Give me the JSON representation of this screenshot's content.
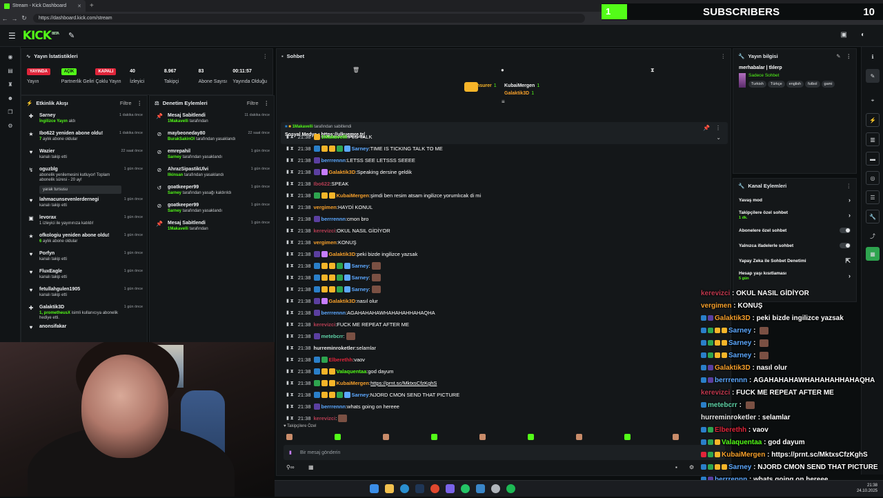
{
  "browser": {
    "tab_title": "Stream - Kick Dashboard",
    "url": "https://dashboard.kick.com/stream"
  },
  "overlay": {
    "subs_bar_value": "1",
    "subs_label": "SUBSCRIBERS",
    "subs_count": "10"
  },
  "app": {
    "logo": "KICK",
    "logo_badge": "BETA"
  },
  "stats": {
    "title": "Yayın İstatistikleri",
    "items": [
      {
        "value": "YAYINDA",
        "label": "Yayın",
        "color": "#e0253a"
      },
      {
        "value": "AÇIK",
        "label": "Partnerlik Geliri",
        "color": "#53fc18"
      },
      {
        "value": "KAPALI",
        "label": "Çoklu Yayın",
        "color": "#e0253a"
      },
      {
        "value": "40",
        "label": "İzleyici"
      },
      {
        "value": "8.967",
        "label": "Takipçi"
      },
      {
        "value": "83",
        "label": "Abone Sayısı"
      },
      {
        "value": "00:11:57",
        "label": "Yayında Olduğu"
      }
    ]
  },
  "feed": {
    "title": "Etkinlik Akışı",
    "filter": "Filtre",
    "items": [
      {
        "icon": "gift",
        "title": "Sarney",
        "sub": "İngilizce Yayın",
        "subrest": " aldı",
        "time": "1 dakika önce"
      },
      {
        "icon": "star",
        "title": "Ibo622 yeniden abone oldu!",
        "sub": "7",
        "subrest": " aylık abone oldular",
        "time": "1 dakika önce"
      },
      {
        "icon": "heart",
        "title": "Wazier",
        "sub": "",
        "subrest": "kanalı takip etti",
        "time": "22 saat önce"
      },
      {
        "icon": "renew",
        "title": "oguzblg",
        "sub": "",
        "subrest": "abonelik yenilemesini kutluyor! Toplam abonelik süresi - 20 ay!",
        "time": "1 gün önce",
        "quote": "yarak tursusu"
      },
      {
        "icon": "heart",
        "title": "lahmacunsevenlerdernegi",
        "sub": "",
        "subrest": "kanalı takip etti",
        "time": "1 gün önce"
      },
      {
        "icon": "tv",
        "title": "levorax",
        "sub": "",
        "subrest": "1 izleyici ile yayınınıza katıldı!",
        "time": "1 gün önce"
      },
      {
        "icon": "star",
        "title": "ofkologiu yeniden abone oldu!",
        "sub": "6",
        "subrest": " aylık abone oldular",
        "time": "1 gün önce"
      },
      {
        "icon": "heart",
        "title": "Porfyn",
        "sub": "",
        "subrest": "kanalı takip etti",
        "time": "1 gün önce"
      },
      {
        "icon": "heart",
        "title": "FluxEagle",
        "sub": "",
        "subrest": "kanalı takip etti",
        "time": "1 gün önce"
      },
      {
        "icon": "heart",
        "title": "fetullahgulen1905",
        "sub": "",
        "subrest": "kanalı takip etti",
        "time": "1 gün önce"
      },
      {
        "icon": "gift",
        "title": "Galaktik3D",
        "sub": "1, prometheusX",
        "subrest": " isimli kullanıcıya abonelik hediye etti.",
        "time": "1 gün önce"
      },
      {
        "icon": "heart",
        "title": "anonsifakar",
        "sub": "",
        "subrest": "",
        "time": ""
      }
    ]
  },
  "mod": {
    "title": "Denetim Eylemleri",
    "filter": "Filtre",
    "items": [
      {
        "icon": "pin",
        "title": "Mesaj Sabitlendi",
        "sub": "1Makavelli",
        "subrest": " tarafından",
        "time": "11 dakika önce"
      },
      {
        "icon": "ban",
        "title": "maybeoneday80",
        "sub": "BurakSakinOl",
        "subrest": " tarafından yasaklandı",
        "time": "22 saat önce"
      },
      {
        "icon": "ban",
        "title": "emrepahil",
        "sub": "Sarney",
        "subrest": " tarafından yasaklandı",
        "time": "1 gün önce"
      },
      {
        "icon": "ban",
        "title": "AhrazSipastikUlvi",
        "sub": "Ilkinsan",
        "subrest": " tarafından yasaklandı",
        "time": "1 gün önce"
      },
      {
        "icon": "undo",
        "title": "goatkeeper99",
        "sub": "Sarney",
        "subrest": " tarafından yasağı kaldırıldı",
        "time": "1 gün önce"
      },
      {
        "icon": "ban",
        "title": "goatkeeper99",
        "sub": "Sarney",
        "subrest": " tarafından yasaklandı",
        "time": "1 gün önce"
      },
      {
        "icon": "pin",
        "title": "Mesaj Sabitlendi",
        "sub": "1Makavelli",
        "subrest": " tarafından",
        "time": "1 gün önce"
      }
    ]
  },
  "chat": {
    "title": "Sohbet",
    "leaders": [
      {
        "name": "Insurer",
        "count": "1",
        "color": "#f7b529"
      },
      {
        "name": "KubaiMergen",
        "count": "1",
        "color": "#f2f2f2"
      },
      {
        "name": "Galaktik3D",
        "count": "1",
        "color": "#f7a02b"
      }
    ],
    "pinned_author": "1Makavelli",
    "pinned_by": "tarafından sabitlendi",
    "pinned_label": "Sosyal Medya : ",
    "pinned_link": "https://ulkuemre.tr/",
    "messages": [
      {
        "time": "21:38",
        "user": "1Makavelli",
        "color": "#53fc18",
        "text": "PLS TALK",
        "badges": [
          "#f7b529"
        ]
      },
      {
        "time": "21:38",
        "user": "Sarney",
        "color": "#5ca8ff",
        "text": "TIME IS TICKING TALK TO ME",
        "badges": [
          "#2a7fc9",
          "#f7b529",
          "#f7b529",
          "#2ea44f",
          "#5ca8ff"
        ]
      },
      {
        "time": "21:38",
        "user": "berrrennn",
        "color": "#5ca8ff",
        "text": "LETSS SEE LETSSS SEEEE",
        "badges": [
          "#5b3fa0"
        ]
      },
      {
        "time": "21:38",
        "user": "Galaktik3D",
        "color": "#f7a02b",
        "text": "Speaking dersine geldik",
        "badges": [
          "#5b3fa0",
          "#c77dff"
        ]
      },
      {
        "time": "21:38",
        "user": "Ibo622",
        "color": "#b43d52",
        "text": "SPEAK",
        "badges": []
      },
      {
        "time": "21:38",
        "user": "KubaiMergen",
        "color": "#f7a02b",
        "text": "şimdi ben resim atsam ingilizce yorumlıcak di mi",
        "badges": [
          "#2ea44f",
          "#f7b529",
          "#f7b529"
        ]
      },
      {
        "time": "21:38",
        "user": "vergimen",
        "color": "#f7a02b",
        "text": "HAYDİ KONUL",
        "badges": []
      },
      {
        "time": "21:38",
        "user": "berrrennn",
        "color": "#5ca8ff",
        "text": "cmon bro",
        "badges": [
          "#5b3fa0"
        ]
      },
      {
        "time": "21:38",
        "user": "kerevizci",
        "color": "#b43d52",
        "text": "OKUL NASIL GİDİYOR",
        "badges": []
      },
      {
        "time": "21:38",
        "user": "vergimen",
        "color": "#f7a02b",
        "text": "KONUŞ",
        "badges": []
      },
      {
        "time": "21:38",
        "user": "Galaktik3D",
        "color": "#f7a02b",
        "text": "peki bizde ingilizce yazsak",
        "badges": [
          "#5b3fa0",
          "#c77dff"
        ]
      },
      {
        "time": "21:38",
        "user": "Sarney",
        "color": "#5ca8ff",
        "text": "",
        "emote": true,
        "badges": [
          "#2a7fc9",
          "#f7b529",
          "#f7b529",
          "#2ea44f",
          "#5ca8ff"
        ]
      },
      {
        "time": "21:38",
        "user": "Sarney",
        "color": "#5ca8ff",
        "text": "",
        "emote": true,
        "badges": [
          "#2a7fc9",
          "#f7b529",
          "#f7b529",
          "#2ea44f",
          "#5ca8ff"
        ]
      },
      {
        "time": "21:38",
        "user": "Sarney",
        "color": "#5ca8ff",
        "text": "",
        "emote": true,
        "badges": [
          "#2a7fc9",
          "#f7b529",
          "#f7b529",
          "#2ea44f",
          "#5ca8ff"
        ]
      },
      {
        "time": "21:38",
        "user": "Galaktik3D",
        "color": "#f7a02b",
        "text": "nasıl olur",
        "badges": [
          "#5b3fa0",
          "#c77dff"
        ]
      },
      {
        "time": "21:38",
        "user": "berrrennn",
        "color": "#5ca8ff",
        "text": "AGAHAHAHAWHAHAHAHHAHAQHA",
        "badges": [
          "#5b3fa0"
        ]
      },
      {
        "time": "21:38",
        "user": "kerevizci",
        "color": "#b43d52",
        "text": "FUCK ME REPEAT AFTER ME",
        "badges": []
      },
      {
        "time": "21:38",
        "user": "metebcrr",
        "color": "#5fd3a8",
        "text": "",
        "emote": true,
        "badges": [
          "#5b3fa0"
        ]
      },
      {
        "time": "21:38",
        "user": "hurreminroketler",
        "color": "#e8e8e8",
        "text": "selamlar",
        "badges": []
      },
      {
        "time": "21:38",
        "user": "Elberethh",
        "color": "#e0253a",
        "text": "vaov",
        "badges": [
          "#2a7fc9",
          "#2ea44f"
        ]
      },
      {
        "time": "21:38",
        "user": "Valaquentaa",
        "color": "#53fc18",
        "text": "god dayum",
        "badges": [
          "#2a7fc9",
          "#f7b529",
          "#f7b529"
        ]
      },
      {
        "time": "21:38",
        "user": "KubaiMergen",
        "color": "#f7a02b",
        "text": "https://prnt.sc/MktxsCfzKghS",
        "link": true,
        "badges": [
          "#2ea44f",
          "#f7b529",
          "#f7b529"
        ]
      },
      {
        "time": "21:38",
        "user": "Sarney",
        "color": "#5ca8ff",
        "text": "NJORD CMON SEND THAT PICTURE",
        "badges": [
          "#2a7fc9",
          "#f7b529",
          "#f7b529",
          "#2ea44f",
          "#5ca8ff"
        ]
      },
      {
        "time": "21:38",
        "user": "berrrennn",
        "color": "#5ca8ff",
        "text": "whats going on hereee",
        "badges": [
          "#5b3fa0"
        ]
      },
      {
        "time": "21:38",
        "user": "kerevizci",
        "color": "#b43d52",
        "text": "",
        "emote": true,
        "badges": []
      }
    ],
    "followers_only": "Takipçilere Özel",
    "input_placeholder": "Bir mesaj gönderin"
  },
  "info": {
    "title": "Yayın bilgisi",
    "stream_title": "merhabalar | tlılerp",
    "category": "Sadece Sohbet",
    "tags": [
      "Turkish",
      "Türkçe",
      "english",
      "futbol",
      "gami"
    ]
  },
  "actions": {
    "title": "Kanal Eylemleri",
    "items": [
      {
        "label": "Yavaş mod",
        "kind": "chev"
      },
      {
        "label": "Takipçilere özel sohbet",
        "sub": "1 dk.",
        "kind": "chev"
      },
      {
        "label": "Abonelere özel sohbet",
        "kind": "toggle"
      },
      {
        "label": "Yalnızca ifadelerle sohbet",
        "kind": "toggle"
      },
      {
        "label": "Yapay Zeka ile Sohbet Denetimi",
        "kind": "ext"
      },
      {
        "label": "Hesap yaşı kısıtlaması",
        "sub": "5 gün",
        "kind": "chev"
      }
    ]
  },
  "overlay_chat": [
    {
      "user": "kerevizci",
      "color": "#c0394f",
      "text": "OKUL NASIL GİDİYOR",
      "badges": []
    },
    {
      "user": "vergimen",
      "color": "#f7a02b",
      "text": "KONUŞ",
      "badges": []
    },
    {
      "user": "Galaktik3D",
      "color": "#f7a02b",
      "text": "peki bizde ingilizce yazsak",
      "badges": [
        "#2a7fc9",
        "#5b3fa0"
      ]
    },
    {
      "user": "Sarney",
      "color": "#5ca8ff",
      "text": "",
      "emote": true,
      "badges": [
        "#2a7fc9",
        "#2ea44f",
        "#f7b529",
        "#f7b529"
      ]
    },
    {
      "user": "Sarney",
      "color": "#5ca8ff",
      "text": "",
      "emote": true,
      "badges": [
        "#2a7fc9",
        "#2ea44f",
        "#f7b529",
        "#f7b529"
      ]
    },
    {
      "user": "Sarney",
      "color": "#5ca8ff",
      "text": "",
      "emote": true,
      "badges": [
        "#2a7fc9",
        "#2ea44f",
        "#f7b529",
        "#f7b529"
      ]
    },
    {
      "user": "Galaktik3D",
      "color": "#f7a02b",
      "text": "nasıl olur",
      "badges": [
        "#2a7fc9",
        "#5b3fa0"
      ]
    },
    {
      "user": "berrrennn",
      "color": "#5ca8ff",
      "text": "AGAHAHAHAWHAHAHAHHAHAQHA",
      "badges": [
        "#2a7fc9",
        "#5b3fa0"
      ]
    },
    {
      "user": "kerevizci",
      "color": "#c0394f",
      "text": "FUCK ME REPEAT AFTER ME",
      "badges": []
    },
    {
      "user": "metebcrr",
      "color": "#5fd3a8",
      "text": "",
      "emote": true,
      "badges": [
        "#2a7fc9"
      ]
    },
    {
      "user": "hurreminroketler",
      "color": "#e8e8e8",
      "text": "selamlar",
      "badges": []
    },
    {
      "user": "Elberethh",
      "color": "#e0253a",
      "text": "vaov",
      "badges": [
        "#2a7fc9",
        "#2ea44f"
      ]
    },
    {
      "user": "Valaquentaa",
      "color": "#53fc18",
      "text": "god dayum",
      "badges": [
        "#2a7fc9",
        "#2ea44f",
        "#f7b529"
      ]
    },
    {
      "user": "KubaiMergen",
      "color": "#f7a02b",
      "text": "https://prnt.sc/MktxsCfzKghS",
      "badges": [
        "#e0253a",
        "#2ea44f",
        "#f7b529"
      ]
    },
    {
      "user": "Sarney",
      "color": "#5ca8ff",
      "text": "NJORD CMON SEND THAT PICTURE",
      "badges": [
        "#2a7fc9",
        "#2ea44f",
        "#f7b529",
        "#f7b529"
      ]
    },
    {
      "user": "berrrennn",
      "color": "#5ca8ff",
      "text": "whats going on hereee",
      "badges": [
        "#2a7fc9",
        "#5b3fa0"
      ]
    },
    {
      "user": "kerevizci",
      "color": "#c0394f",
      "text": "",
      "emote": true,
      "badges": []
    }
  ],
  "taskbar": {
    "time": "21:38",
    "date": "24.10.2025"
  },
  "colors": {
    "kick_green": "#53fc18",
    "live_red": "#e0253a",
    "panel_bg": "#141719"
  }
}
